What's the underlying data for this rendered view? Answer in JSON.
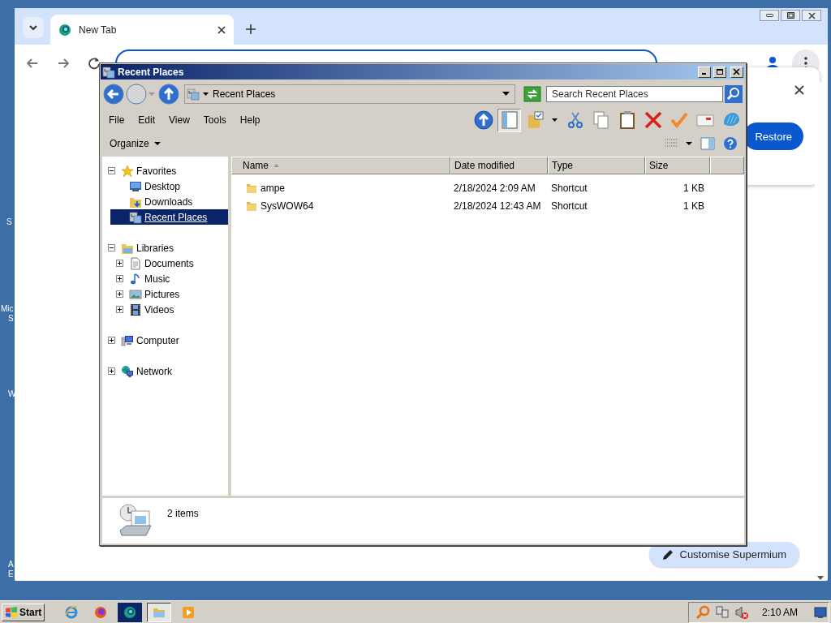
{
  "desktop": {
    "icon_labels": [
      "S",
      "Mic",
      "S",
      "W",
      "A",
      "E"
    ]
  },
  "browser": {
    "tabs": [
      {
        "title": "New Tab",
        "selected": true
      }
    ],
    "popup": {
      "button": "Restore"
    },
    "customise_button": "Customise Supermium"
  },
  "explorer": {
    "title": "Recent Places",
    "address": "Recent Places",
    "search": {
      "placeholder": "Search Recent Places"
    },
    "menu": [
      "File",
      "Edit",
      "View",
      "Tools",
      "Help"
    ],
    "toolbar": [
      {
        "kind": "up",
        "selected": false
      },
      {
        "kind": "pane",
        "selected": true
      },
      {
        "kind": "properties",
        "selected": false
      },
      {
        "kind": "cut",
        "selected": false
      },
      {
        "kind": "copy",
        "selected": false
      },
      {
        "kind": "paste",
        "selected": false
      },
      {
        "kind": "delete",
        "selected": false
      },
      {
        "kind": "apply",
        "selected": false
      },
      {
        "kind": "mail",
        "selected": false
      },
      {
        "kind": "shell",
        "selected": false
      }
    ],
    "organize": "Organize",
    "nav": [
      {
        "label": "Favorites",
        "kind": "star",
        "expanded": true,
        "selected": false,
        "children": [
          {
            "label": "Desktop",
            "kind": "desktop",
            "selected": false
          },
          {
            "label": "Downloads",
            "kind": "downloads",
            "selected": false
          },
          {
            "label": "Recent Places",
            "kind": "recent",
            "selected": true
          }
        ]
      },
      {
        "label": "Libraries",
        "kind": "library",
        "expanded": true,
        "selected": false,
        "children": [
          {
            "label": "Documents",
            "kind": "documents",
            "expanded": false,
            "selected": false
          },
          {
            "label": "Music",
            "kind": "music",
            "expanded": false,
            "selected": false
          },
          {
            "label": "Pictures",
            "kind": "pictures",
            "expanded": false,
            "selected": false
          },
          {
            "label": "Videos",
            "kind": "videos",
            "expanded": false,
            "selected": false
          }
        ]
      },
      {
        "label": "Computer",
        "kind": "computer",
        "expanded": false,
        "selected": false
      },
      {
        "label": "Network",
        "kind": "network",
        "expanded": false,
        "selected": false
      }
    ],
    "columns": [
      {
        "label": "Name",
        "sorted": true
      },
      {
        "label": "Date modified",
        "sorted": false
      },
      {
        "label": "Type",
        "sorted": false
      },
      {
        "label": "Size",
        "sorted": false
      }
    ],
    "rows": [
      {
        "name": "ampe",
        "date": "2/18/2024 2:09 AM",
        "type": "Shortcut",
        "size": "1 KB",
        "selected": false
      },
      {
        "name": "SysWOW64",
        "date": "2/18/2024 12:43 AM",
        "type": "Shortcut",
        "size": "1 KB",
        "selected": false
      }
    ],
    "status": "2 items"
  },
  "taskbar": {
    "start": "Start",
    "apps": [
      {
        "kind": "ie",
        "selected": false
      },
      {
        "kind": "firefox",
        "selected": false
      },
      {
        "kind": "supermium",
        "selected": false
      },
      {
        "kind": "explorer",
        "selected": true
      },
      {
        "kind": "media",
        "selected": false
      }
    ],
    "clock": "2:10 AM"
  }
}
